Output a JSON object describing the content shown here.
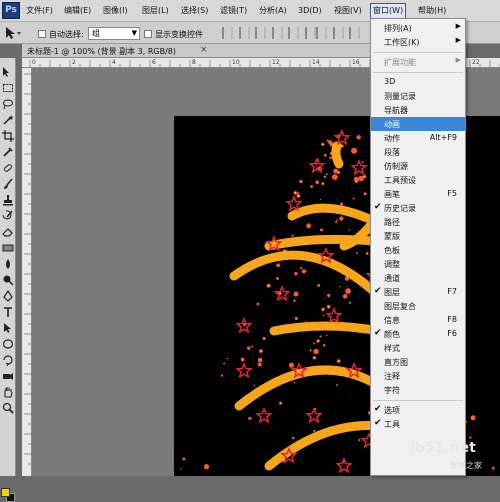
{
  "app": {
    "logo": "Ps"
  },
  "menubar": {
    "items": [
      "文件(F)",
      "编辑(E)",
      "图像(I)",
      "图层(L)",
      "选择(S)",
      "滤镜(T)",
      "分析(A)",
      "3D(D)",
      "视图(V)",
      "窗口(W)",
      "帮助(H)"
    ],
    "active": "窗口(W)"
  },
  "options": {
    "auto_select_label": "自动选择:",
    "auto_select_value": "组",
    "show_transform_label": "显示变换控件"
  },
  "document": {
    "tab_title": "未标题-1 @ 100% (背景 副本 3, RGB/8)",
    "close": "×"
  },
  "rulers": {
    "top": [
      "0",
      "2",
      "4",
      "6",
      "8",
      "10",
      "12",
      "14",
      "16",
      "18",
      "20",
      "22"
    ]
  },
  "window_menu": {
    "items": [
      {
        "label": "排列(A)",
        "shortcut": "",
        "submenu": true
      },
      {
        "label": "工作区(K)",
        "shortcut": "",
        "submenu": true
      },
      {
        "label": "扩展功能",
        "shortcut": "",
        "submenu": true,
        "disabled": true
      },
      {
        "label": "3D",
        "shortcut": ""
      },
      {
        "label": "测量记录",
        "shortcut": ""
      },
      {
        "label": "导航器",
        "shortcut": ""
      },
      {
        "label": "动画",
        "shortcut": "",
        "highlighted": true
      },
      {
        "label": "动作",
        "shortcut": "Alt+F9"
      },
      {
        "label": "段落",
        "shortcut": ""
      },
      {
        "label": "仿制源",
        "shortcut": ""
      },
      {
        "label": "工具预设",
        "shortcut": ""
      },
      {
        "label": "画笔",
        "shortcut": "F5"
      },
      {
        "label": "历史记录",
        "shortcut": "",
        "checked": true
      },
      {
        "label": "路径",
        "shortcut": ""
      },
      {
        "label": "蒙版",
        "shortcut": ""
      },
      {
        "label": "色板",
        "shortcut": ""
      },
      {
        "label": "调整",
        "shortcut": ""
      },
      {
        "label": "通道",
        "shortcut": ""
      },
      {
        "label": "图层",
        "shortcut": "F7",
        "checked": true
      },
      {
        "label": "图层复合",
        "shortcut": ""
      },
      {
        "label": "信息",
        "shortcut": "F8"
      },
      {
        "label": "颜色",
        "shortcut": "F6",
        "checked": true
      },
      {
        "label": "样式",
        "shortcut": ""
      },
      {
        "label": "直方图",
        "shortcut": ""
      },
      {
        "label": "注释",
        "shortcut": ""
      },
      {
        "label": "字符",
        "shortcut": ""
      },
      {
        "label": "选项",
        "shortcut": "",
        "checked": true
      },
      {
        "label": "工具",
        "shortcut": "",
        "checked": true
      }
    ]
  },
  "watermark": {
    "logo": "jb51.net",
    "sub": "脚本之家"
  },
  "colors": {
    "foreground": "#f0d400",
    "background": "#111111",
    "highlight": "#3b86d6",
    "tree_stroke": "#f7a61b",
    "star": "#e0243a"
  }
}
